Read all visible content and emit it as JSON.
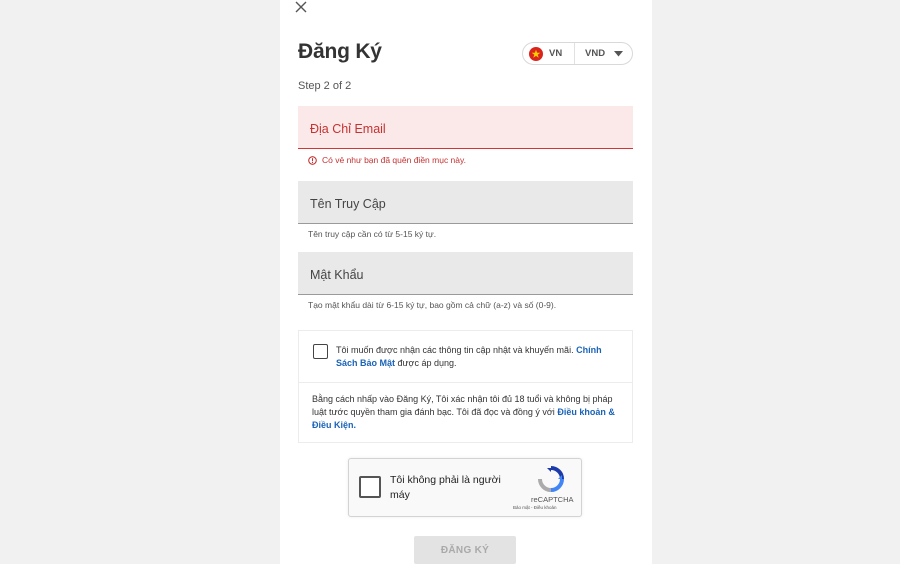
{
  "modal": {
    "title": "Đăng Ký",
    "step": "Step 2 of 2"
  },
  "locale": {
    "country_code": "VN",
    "currency": "VND",
    "flag_color": "#da251d"
  },
  "fields": {
    "email": {
      "placeholder": "Địa Chỉ Email",
      "value": "",
      "error": "Có vẻ như bạn đã quên điền mục này."
    },
    "username": {
      "placeholder": "Tên Truy Cập",
      "value": "",
      "hint": "Tên truy cập cần có từ 5-15 ký tự."
    },
    "password": {
      "placeholder": "Mật Khẩu",
      "value": "",
      "hint": "Tạo mật khẩu dài từ 6-15 ký tự, bao gồm cả chữ (a-z) và số (0-9)."
    }
  },
  "consent": {
    "opt_in_text": "Tôi muốn được nhận các thông tin cập nhật và khuyến mãi.",
    "privacy_link": "Chính Sách Bảo Mật",
    "opt_in_suffix": "được áp dụng.",
    "checked": false,
    "terms_text": "Bằng cách nhấp vào Đăng Ký, Tôi xác nhận tôi đủ 18 tuổi và không bị pháp luật tước quyền tham gia đánh bạc. Tôi đã đọc và đồng ý với",
    "terms_link": "Điều khoản & Điều Kiện."
  },
  "recaptcha": {
    "label": "Tôi không phải là người máy",
    "brand": "reCAPTCHA",
    "links": "Bảo mật - Điều khoản"
  },
  "submit_label": "ĐĂNG KÝ",
  "colors": {
    "error": "#c43232",
    "link": "#1a63b8"
  }
}
